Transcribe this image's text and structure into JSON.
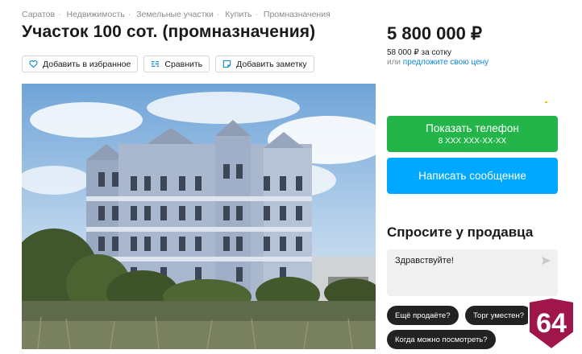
{
  "breadcrumbs": [
    "Саратов",
    "Недвижимость",
    "Земельные участки",
    "Купить",
    "Промназначения"
  ],
  "title": "Участок 100 сот. (промназначения)",
  "actions": {
    "favorite": "Добавить в избранное",
    "compare": "Сравнить",
    "note": "Добавить заметку"
  },
  "price": {
    "value": "5 800 000 ₽",
    "per_unit": "58 000 ₽ за сотку",
    "offer_prefix": "или",
    "offer_link": "предложите свою цену"
  },
  "contact": {
    "phone_button": "Показать телефон",
    "phone_masked": "8 XXX XXX-XX-XX",
    "message_button": "Написать сообщение"
  },
  "ask_seller": {
    "title": "Спросите у продавца",
    "message": "Здравствуйте!",
    "quick_questions": [
      "Ещё продаёте?",
      "Торг уместен?",
      "Когда можно посмотреть?"
    ]
  },
  "watermark": "64",
  "colors": {
    "call_green": "#23b44a",
    "message_blue": "#00a9ff",
    "link_blue": "#0a86d6",
    "watermark_crimson": "#a0164b"
  }
}
